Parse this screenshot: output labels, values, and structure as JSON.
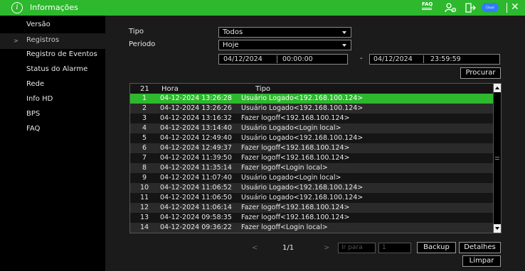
{
  "window": {
    "title": "Informações",
    "icons": [
      "info-icon",
      "faq-icon",
      "users-icon",
      "exit-icon",
      "cloud-icon",
      "close-icon"
    ],
    "faq_label": "FAQ",
    "cloud_label": "Cloud",
    "accent_color": "#2db82d"
  },
  "sidebar": {
    "items": [
      {
        "label": "Versão"
      },
      {
        "label": "Registros"
      },
      {
        "label": "Registro de Eventos"
      },
      {
        "label": "Status do Alarme"
      },
      {
        "label": "Rede"
      },
      {
        "label": "Info HD"
      },
      {
        "label": "BPS"
      },
      {
        "label": "FAQ"
      }
    ],
    "active_index": 1
  },
  "filters": {
    "tipo_label": "Tipo",
    "tipo_value": "Todos",
    "periodo_label": "Periodo",
    "periodo_value": "Hoje",
    "start_date": "04/12/2024",
    "start_time": "00:00:00",
    "separator": "-",
    "end_date": "04/12/2024",
    "end_time": "23:59:59",
    "search_label": "Procurar"
  },
  "table": {
    "headers": {
      "count": "21",
      "hora": "Hora",
      "tipo": "Tipo"
    },
    "selected_index": 0,
    "rows": [
      {
        "num": "1",
        "hora": "04-12-2024 13:26:28",
        "tipo": "Usuário Logado<192.168.100.124>"
      },
      {
        "num": "2",
        "hora": "04-12-2024 13:26:26",
        "tipo": "Usuário Logado<192.168.100.124>"
      },
      {
        "num": "3",
        "hora": "04-12-2024 13:16:32",
        "tipo": "Fazer logoff<192.168.100.124>"
      },
      {
        "num": "4",
        "hora": "04-12-2024 13:14:40",
        "tipo": "Usuário Logado<Login local>"
      },
      {
        "num": "5",
        "hora": "04-12-2024 12:49:40",
        "tipo": "Usuário Logado<192.168.100.124>"
      },
      {
        "num": "6",
        "hora": "04-12-2024 12:49:37",
        "tipo": "Fazer logoff<192.168.100.124>"
      },
      {
        "num": "7",
        "hora": "04-12-2024 11:39:50",
        "tipo": "Fazer logoff<192.168.100.124>"
      },
      {
        "num": "8",
        "hora": "04-12-2024 11:35:14",
        "tipo": "Fazer logoff<Login local>"
      },
      {
        "num": "9",
        "hora": "04-12-2024 11:07:40",
        "tipo": "Usuário Logado<Login local>"
      },
      {
        "num": "10",
        "hora": "04-12-2024 11:06:52",
        "tipo": "Usuário Logado<192.168.100.124>"
      },
      {
        "num": "11",
        "hora": "04-12-2024 11:06:50",
        "tipo": "Usuário Logado<192.168.100.124>"
      },
      {
        "num": "12",
        "hora": "04-12-2024 11:06:14",
        "tipo": "Fazer logoff<192.168.100.124>"
      },
      {
        "num": "13",
        "hora": "04-12-2024 09:58:35",
        "tipo": "Fazer logoff<192.168.100.124>"
      },
      {
        "num": "14",
        "hora": "04-12-2024 09:36:22",
        "tipo": "Fazer logoff<Login local>"
      }
    ]
  },
  "pagination": {
    "prev_symbol": "<",
    "next_symbol": ">",
    "page": "1/1",
    "goto_label": "Ir para",
    "goto_value": "1"
  },
  "actions": {
    "backup_label": "Backup",
    "details_label": "Detalhes",
    "clear_label": "Limpar"
  }
}
